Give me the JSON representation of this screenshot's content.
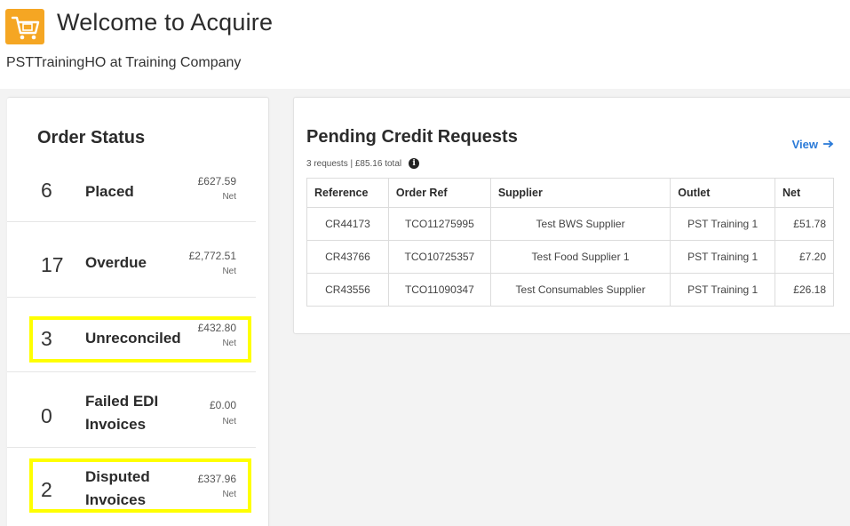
{
  "header": {
    "title": "Welcome to Acquire",
    "subtitle": "PSTTrainingHO at Training Company",
    "logo_icon": "shopping-cart-icon",
    "logo_color": "#f5a623"
  },
  "order_status": {
    "heading": "Order Status",
    "rows": [
      {
        "count": "6",
        "label": "Placed",
        "amount": "£627.59",
        "net": "Net",
        "highlighted": false
      },
      {
        "count": "17",
        "label": "Overdue",
        "amount": "£2,772.51",
        "net": "Net",
        "highlighted": false
      },
      {
        "count": "3",
        "label": "Unreconciled",
        "amount": "£432.80",
        "net": "Net",
        "highlighted": true
      },
      {
        "count": "0",
        "label": "Failed EDI Invoices",
        "amount": "£0.00",
        "net": "Net",
        "highlighted": false
      },
      {
        "count": "2",
        "label": "Disputed Invoices",
        "amount": "£337.96",
        "net": "Net",
        "highlighted": true
      }
    ]
  },
  "credit_requests": {
    "heading": "Pending Credit Requests",
    "summary": "3 requests | £85.16 total",
    "view_label": "View",
    "view_icon": "arrow-right-icon",
    "link_color": "#2a7ad8",
    "columns": [
      "Reference",
      "Order Ref",
      "Supplier",
      "Outlet",
      "Net"
    ],
    "rows": [
      {
        "reference": "CR44173",
        "order_ref": "TCO11275995",
        "supplier": "Test BWS Supplier",
        "outlet": "PST Training 1",
        "net": "£51.78"
      },
      {
        "reference": "CR43766",
        "order_ref": "TCO10725357",
        "supplier": "Test Food Supplier 1",
        "outlet": "PST Training 1",
        "net": "£7.20"
      },
      {
        "reference": "CR43556",
        "order_ref": "TCO11090347",
        "supplier": "Test Consumables Supplier",
        "outlet": "PST Training 1",
        "net": "£26.18"
      }
    ]
  },
  "highlight_color": "#ffff00"
}
